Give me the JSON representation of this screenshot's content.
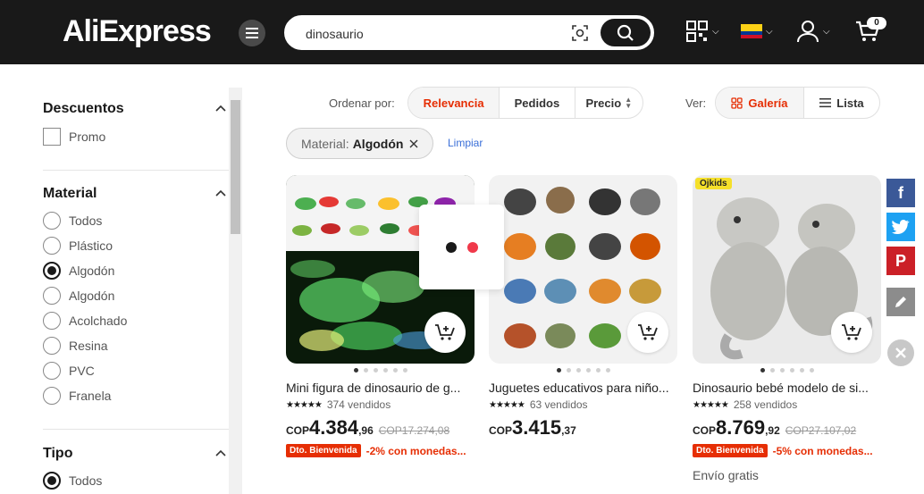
{
  "header": {
    "logo": "AliExpress",
    "search_value": "dinosaurio",
    "cart_count": "0"
  },
  "sidebar": {
    "descuentos": {
      "title": "Descuentos",
      "options": [
        "Promo"
      ]
    },
    "material": {
      "title": "Material",
      "options": [
        "Todos",
        "Plástico",
        "Algodón",
        "Algodón",
        "Acolchado",
        "Resina",
        "PVC",
        "Franela"
      ],
      "selected_index": 2
    },
    "tipo": {
      "title": "Tipo",
      "options": [
        "Todos"
      ],
      "selected_index": 0
    }
  },
  "toolbar": {
    "sort_label": "Ordenar por:",
    "sort_options": [
      "Relevancia",
      "Pedidos",
      "Precio"
    ],
    "view_label": "Ver:",
    "view_options": [
      "Galería",
      "Lista"
    ],
    "filter_chip_key": "Material:",
    "filter_chip_value": "Algodón",
    "clear_label": "Limpiar"
  },
  "products": [
    {
      "title": "Mini figura de dinosaurio de g...",
      "sold": "374 vendidos",
      "currency": "COP",
      "price_int": "4.384",
      "price_dec": ",96",
      "old_price": "COP17.274,08",
      "badge": "Dto. Bienvenida",
      "promo": "-2% con monedas...",
      "shipping": ""
    },
    {
      "title": "Juguetes educativos para niño...",
      "sold": "63 vendidos",
      "currency": "COP",
      "price_int": "3.415",
      "price_dec": ",37",
      "old_price": "",
      "badge": "",
      "promo": "",
      "shipping": ""
    },
    {
      "title": "Dinosaurio bebé modelo de si...",
      "sold": "258 vendidos",
      "currency": "COP",
      "price_int": "8.769",
      "price_dec": ",92",
      "old_price": "COP27.107,02",
      "badge": "Dto. Bienvenida",
      "promo": "-5% con monedas...",
      "shipping": "Envío gratis",
      "tag": "Ojkids"
    }
  ],
  "colors": {
    "accent": "#e62e04",
    "header_bg": "#191919",
    "facebook": "#3b5998",
    "twitter": "#1da1f2",
    "pinterest": "#cb2027",
    "edit": "#8c8c8c"
  }
}
